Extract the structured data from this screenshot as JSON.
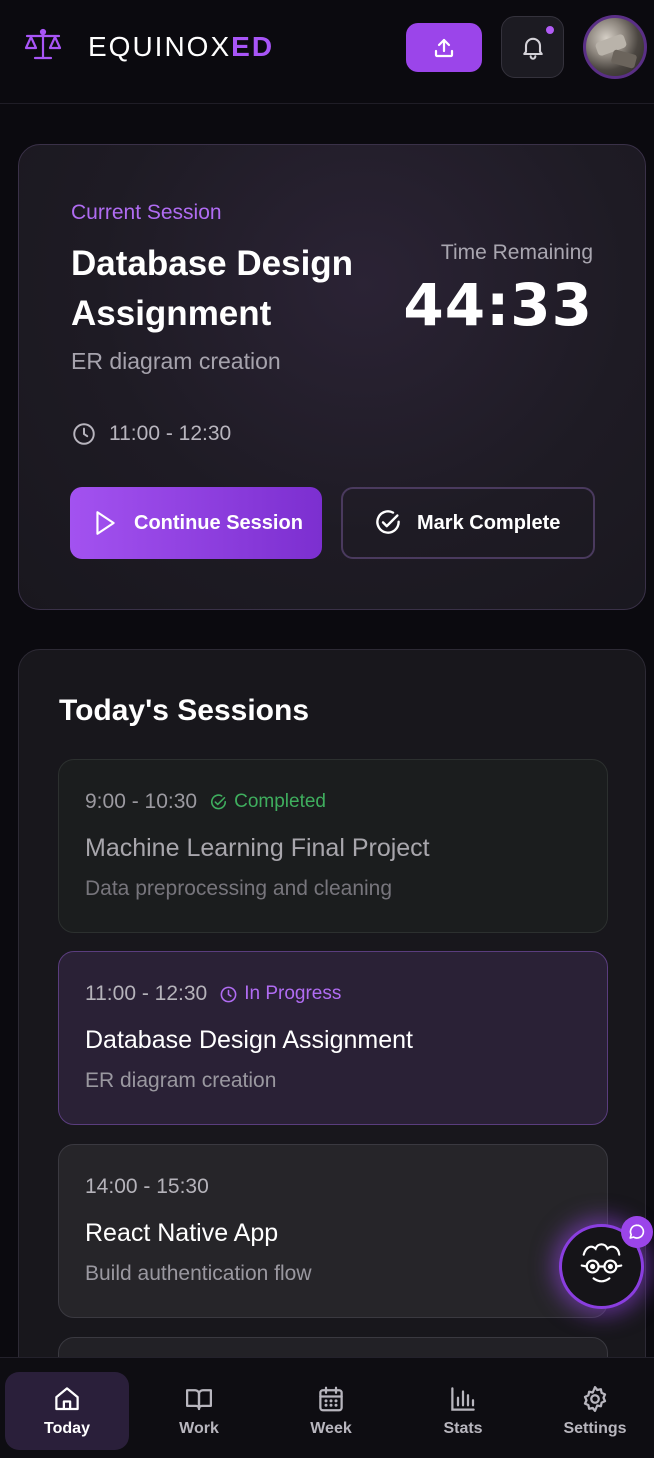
{
  "header": {
    "brand_main": "EQUINOX",
    "brand_accent": "ED",
    "notification_dot": true,
    "accent_color": "#9b45ea"
  },
  "current_session": {
    "label": "Current Session",
    "title": "Database Design Assignment",
    "subtitle": "ER diagram creation",
    "time_range": "11:00 - 12:30",
    "time_remaining_label": "Time Remaining",
    "time_remaining": "44:33",
    "continue_label": "Continue Session",
    "complete_label": "Mark Complete"
  },
  "today": {
    "title": "Today's Sessions",
    "sessions": [
      {
        "time": "9:00 - 10:30",
        "status": "Completed",
        "title": "Machine Learning Final Project",
        "subtitle": "Data preprocessing and cleaning"
      },
      {
        "time": "11:00 - 12:30",
        "status": "In Progress",
        "title": "Database Design Assignment",
        "subtitle": "ER diagram creation"
      },
      {
        "time": "14:00 - 15:30",
        "status": "",
        "title": "React Native App",
        "subtitle": "Build authentication flow"
      }
    ]
  },
  "nav": {
    "items": [
      {
        "label": "Today",
        "icon": "home-icon",
        "active": true
      },
      {
        "label": "Work",
        "icon": "book-icon",
        "active": false
      },
      {
        "label": "Week",
        "icon": "calendar-icon",
        "active": false
      },
      {
        "label": "Stats",
        "icon": "bar-chart-icon",
        "active": false
      },
      {
        "label": "Settings",
        "icon": "gear-icon",
        "active": false
      }
    ]
  }
}
